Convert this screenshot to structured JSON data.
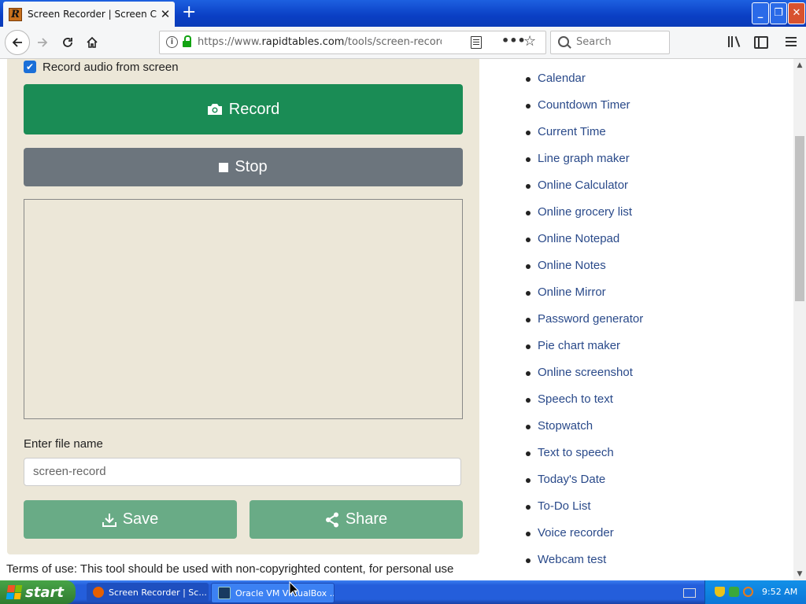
{
  "browser": {
    "tab_title": "Screen Recorder | Screen Cast Or",
    "favicon_letter": "R",
    "url_prefix": "https://www.",
    "url_domain": "rapidtables.com",
    "url_path": "/tools/screen-recorder.h",
    "search_placeholder": "Search",
    "new_tab_glyph": "+",
    "tab_close_glyph": "✕"
  },
  "window_controls": {
    "minimize": "_",
    "maximize": "❐",
    "close": "✕"
  },
  "recorder": {
    "audio_checked": true,
    "audio_label": "Record audio from screen",
    "record_label": "Record",
    "stop_label": "Stop",
    "file_name_label": "Enter file name",
    "file_name_value": "screen-record",
    "save_label": "Save",
    "share_label": "Share"
  },
  "terms_text": "Terms of use: This tool should be used with non-copyrighted content, for personal use",
  "tool_links": [
    "Calendar",
    "Countdown Timer",
    "Current Time",
    "Line graph maker",
    "Online Calculator",
    "Online grocery list",
    "Online Notepad",
    "Online Notes",
    "Online Mirror",
    "Password generator",
    "Pie chart maker",
    "Online screenshot",
    "Speech to text",
    "Stopwatch",
    "Text to speech",
    "Today's Date",
    "To-Do List",
    "Voice recorder",
    "Webcam test"
  ],
  "taskbar": {
    "start_label": "start",
    "tasks": [
      "Screen Recorder | Sc...",
      "Oracle VM VirtualBox ..."
    ],
    "clock": "9:52 AM"
  },
  "colors": {
    "record": "#1a8c55",
    "stop": "#6c757d",
    "save_share": "#69ab86",
    "panel": "#ece7d8",
    "link": "#2a4a8a"
  }
}
